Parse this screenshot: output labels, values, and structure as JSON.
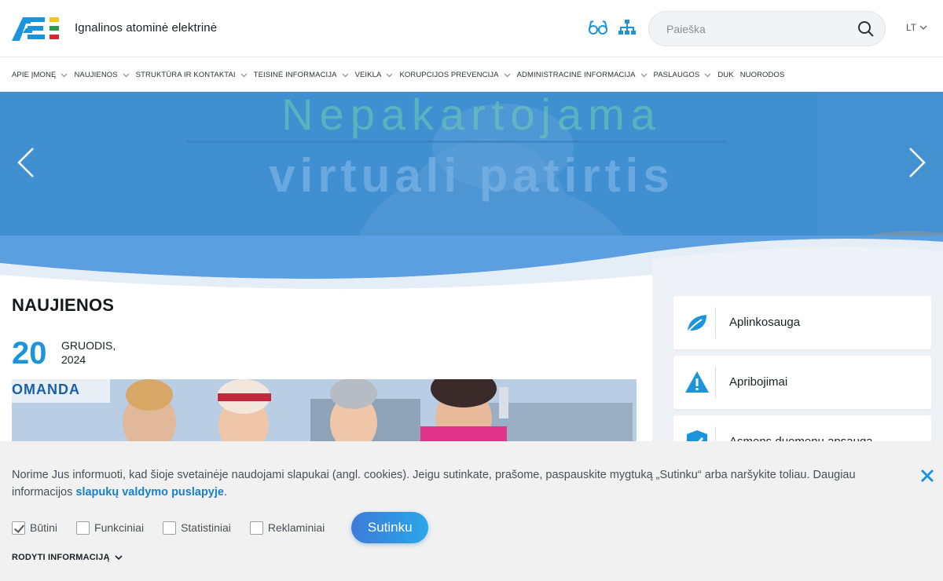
{
  "header": {
    "site_name": "Ignalinos atominė elektrinė",
    "search_placeholder": "Paieška",
    "language": "LT"
  },
  "nav": {
    "items": [
      {
        "label": "Apie įmonę",
        "has_dropdown": true
      },
      {
        "label": "Naujienos",
        "has_dropdown": true
      },
      {
        "label": "Struktūra ir kontaktai",
        "has_dropdown": true
      },
      {
        "label": "Teisinė informacija",
        "has_dropdown": true
      },
      {
        "label": "Veikla",
        "has_dropdown": true
      },
      {
        "label": "Korupcijos prevencija",
        "has_dropdown": true
      },
      {
        "label": "Administracinė informacija",
        "has_dropdown": true
      },
      {
        "label": "Paslaugos",
        "has_dropdown": true
      },
      {
        "label": "DUK",
        "has_dropdown": false
      },
      {
        "label": "Nuorodos",
        "has_dropdown": false
      }
    ]
  },
  "hero": {
    "line1": "Nepakartojama",
    "line2": "virtuali patirtis"
  },
  "news": {
    "title": "NAUJIENOS",
    "day": "20",
    "month": "GRUODIS,",
    "year": "2024",
    "image_banner_text": "OMANDA"
  },
  "quick_links": [
    {
      "label": "Aplinkosauga",
      "icon": "leaf-icon"
    },
    {
      "label": "Apribojimai",
      "icon": "warning-icon"
    },
    {
      "label": "Asmens duomenų apsauga",
      "icon": "shield-check-icon"
    }
  ],
  "cookie": {
    "text": "Norime Jus informuoti, kad šioje svetainėje naudojami slapukai (angl. cookies). Jeigu sutinkate, prašome, paspauskite mygtuką „Sutinku“ arba naršykite toliau. Daugiau informacijos ",
    "link_text": "slapukų valdymo puslapyje",
    "link_suffix": ".",
    "options": [
      {
        "label": "Būtini",
        "checked": true
      },
      {
        "label": "Funkciniai",
        "checked": false
      },
      {
        "label": "Statistiniai",
        "checked": false
      },
      {
        "label": "Reklaminiai",
        "checked": false
      }
    ],
    "accept_label": "Sutinku",
    "show_info_label": "RODYTI INFORMACIJĄ"
  },
  "colors": {
    "accent": "#1a94da",
    "hero_blue": "#3d8ccf",
    "logo_red": "#d8272e",
    "logo_green": "#2e9d48",
    "logo_yellow": "#f5c518"
  }
}
